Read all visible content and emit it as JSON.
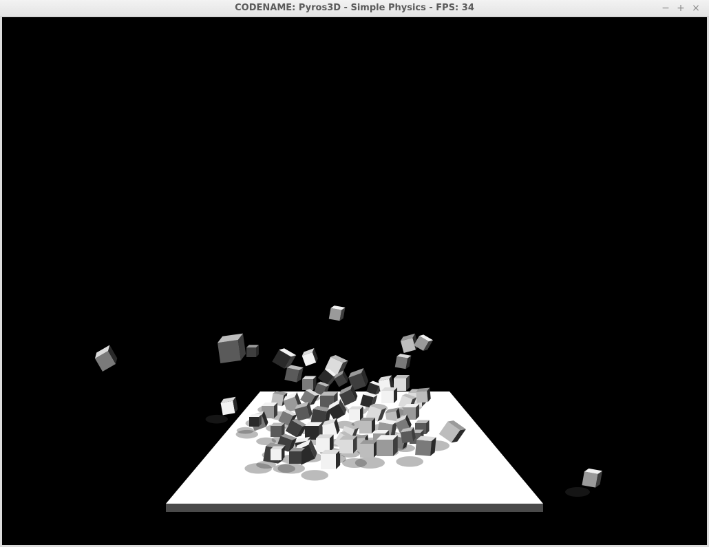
{
  "window": {
    "title": "CODENAME: Pyros3D - Simple Physics - FPS: 34",
    "controls": [
      {
        "name": "minimize",
        "glyph": "−"
      },
      {
        "name": "maximize",
        "glyph": "+"
      },
      {
        "name": "close",
        "glyph": "×"
      }
    ]
  },
  "scene": {
    "background": "#000000",
    "platform_color": "#ffffff",
    "platform_edge_color": "#4a4a4a",
    "cube_light": "#f2f2f2",
    "cube_mid": "#8c8c8c",
    "cube_dark": "#2e2e2e"
  }
}
